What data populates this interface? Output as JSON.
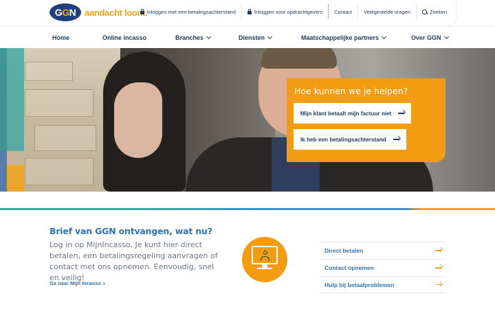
{
  "brand": {
    "logo_text_g1": "G",
    "logo_text_g2": "G",
    "logo_text_n": "N",
    "tagline": "aandacht loont."
  },
  "toplinks": [
    {
      "label": "Inloggen met een betalingsachterstand",
      "icon": "lock-icon"
    },
    {
      "label": "Inloggen voor opdrachtgevers",
      "icon": "lock-icon"
    },
    {
      "label": "Contact"
    },
    {
      "label": "Veelgestelde vragen"
    },
    {
      "label": "Zoeken",
      "icon": "search-icon"
    }
  ],
  "nav": [
    {
      "label": "Home"
    },
    {
      "label": "Online incasso"
    },
    {
      "label": "Branches",
      "dropdown": true
    },
    {
      "label": "Diensten",
      "dropdown": true
    },
    {
      "label": "Maatschappelijke partners",
      "dropdown": true
    },
    {
      "label": "Over GGN",
      "dropdown": true
    }
  ],
  "hero": {
    "help_title": "Hoe kunnen we je helpen?",
    "buttons": [
      {
        "label": "Mijn klant betaalt mijn factuur niet"
      },
      {
        "label": "Ik heb een betalingsachterstand"
      }
    ]
  },
  "brief": {
    "title": "Brief van GGN ontvangen, wat nu?",
    "text": "Log in op MijnIncasso. Je kunt hier direct betalen, een betalingsregeling aanvragen of contact met ons opnemen. Eenvoudig, snel en veilig!",
    "link": "Ga naar Mijn Incasso »"
  },
  "quick_links": [
    {
      "label": "Direct betalen"
    },
    {
      "label": "Contact opnemen"
    },
    {
      "label": "Hulp bij betaalproblemen"
    }
  ],
  "colors": {
    "navy": "#1f3a5f",
    "orange": "#f39c12",
    "blue": "#2f72b0",
    "teal": "#3aa6a0"
  }
}
